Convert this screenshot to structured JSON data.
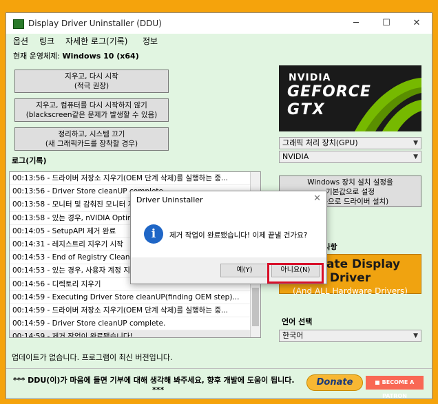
{
  "window": {
    "title": "Display Driver Uninstaller (DDU)",
    "minimize": "─",
    "maximize": "☐",
    "close": "✕"
  },
  "menu": [
    "옵션",
    "링크",
    "자세한 로그(기록)",
    "정보"
  ],
  "os_info": {
    "label": "현재 운영체제:",
    "value": "Windows 10 (x64)"
  },
  "actions": {
    "clean_restart": [
      "지우고, 다시 시작",
      "(적극 권장)"
    ],
    "clean_no_restart": [
      "지우고, 컴퓨터를 다시 시작하지 않기",
      "(blackscreen같은 문제가 발생할 수 있음)"
    ],
    "clean_shutdown": [
      "정리하고, 시스템 끄기",
      "(새 그래픽카드를 장착할 경우)"
    ]
  },
  "log": {
    "label": "로그(기록)",
    "entries": [
      "00:13:56 - 드라이버 저장소 지우기(OEM 단계 삭제)를 실행하는 중...",
      "00:13:56 - Driver Store cleanUP complete.",
      "00:13:58 - 모니터 및 감춰진 모니터 지우기.",
      "00:13:58 - 있는 경우, nVIDIA Optimus 지우기.",
      "00:14:05 - SetupAPI 제거 완료",
      "00:14:31 - 레지스트리 지우기 시작",
      "00:14:53 - End of Registry Cleaning",
      "00:14:53 - 있는 경우, 사용자 계정 지우기",
      "00:14:56 - 디렉토리 지우기",
      "00:14:59 - Executing Driver Store cleanUP(finding OEM step)...",
      "00:14:59 - 드라이버 저장소 지우기(OEM 단계 삭제)를 실행하는 중...",
      "00:14:59 - Driver Store cleanUP complete.",
      "00:14:59 - 제거 작업이 완료됐습니다!"
    ]
  },
  "logo": {
    "line1": "NVIDIA",
    "line2": "GEFORCE",
    "line3": "GTX"
  },
  "device_type": "그래픽 처리 장치(GPU)",
  "vendor": "NVIDIA",
  "windows_setting_button": [
    "Windows 장치 설치 설정을",
    "기본값으로 설정",
    "(자동으로 드라이버 설치)"
  ],
  "partner_label": "파트너의 제한 사항",
  "banner": {
    "line1": "Update Display Driver",
    "line2": "(And ALL Hardware Drivers)"
  },
  "language": {
    "label": "언어 선택",
    "value": "한국어"
  },
  "status_text": "업데이트가 없습니다. 프로그램이 최신 버전입니다.",
  "footer": {
    "message": "*** DDU(이)가 마음에 들면 기부에 대해 생각해 봐주세요, 향후 개발에 도움이 됩니다.",
    "stars": "***",
    "donate": "Donate",
    "patron": "BECOME A PATRON"
  },
  "dialog": {
    "title": "Driver Uninstaller",
    "close": "✕",
    "icon": "i",
    "message": "제거 작업이 완료됐습니다! 이제 끝낼 건가요?",
    "yes": "예(Y)",
    "no": "아니요(N)"
  },
  "colors": {
    "window_bg": "#e1f5e1",
    "outer_bg": "#f5a30c",
    "highlight": "#d8102a",
    "banner": "#f0a310"
  }
}
